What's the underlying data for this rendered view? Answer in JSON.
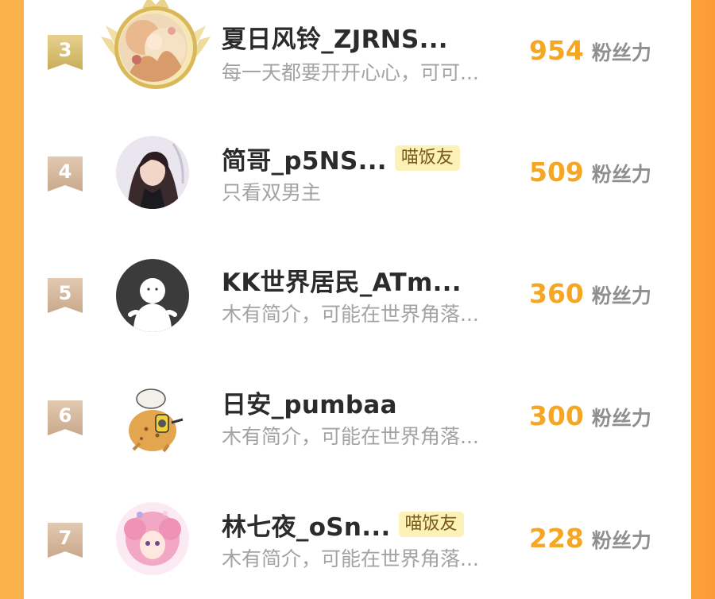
{
  "colors": {
    "accent_orange": "#f5a623",
    "rank_gold": "#d4bb6c",
    "rank_bronze": "#d6b89c",
    "tag_background": "#fcf1b6",
    "name_text": "#2b2b2b",
    "bio_text": "#a3a3a3"
  },
  "ranking": [
    {
      "rank": "3",
      "name": "夏日风铃_ZJRNS...",
      "tag": "",
      "bio": "每一天都要开开心心，可可...",
      "score": "954",
      "unit": "粉丝力",
      "avatar": "anime-illustration-avatar",
      "frame": "gold-laurel-crown-frame"
    },
    {
      "rank": "4",
      "name": "简哥_p5NS...",
      "tag": "喵饭友",
      "bio": "只看双男主",
      "score": "509",
      "unit": "粉丝力",
      "avatar": "dark-haired-character-avatar"
    },
    {
      "rank": "5",
      "name": "KK世界居民_ATm...",
      "tag": "",
      "bio": "木有简介，可能在世界角落...",
      "score": "360",
      "unit": "粉丝力",
      "avatar": "default-user-avatar"
    },
    {
      "rank": "6",
      "name": "日安_pumbaa",
      "tag": "",
      "bio": "木有简介，可能在世界角落...",
      "score": "300",
      "unit": "粉丝力",
      "avatar": "cartoon-creature-avatar"
    },
    {
      "rank": "7",
      "name": "林七夜_oSn...",
      "tag": "喵饭友",
      "bio": "木有简介，可能在世界角落...",
      "score": "228",
      "unit": "粉丝力",
      "avatar": "pink-haired-girl-avatar"
    }
  ]
}
